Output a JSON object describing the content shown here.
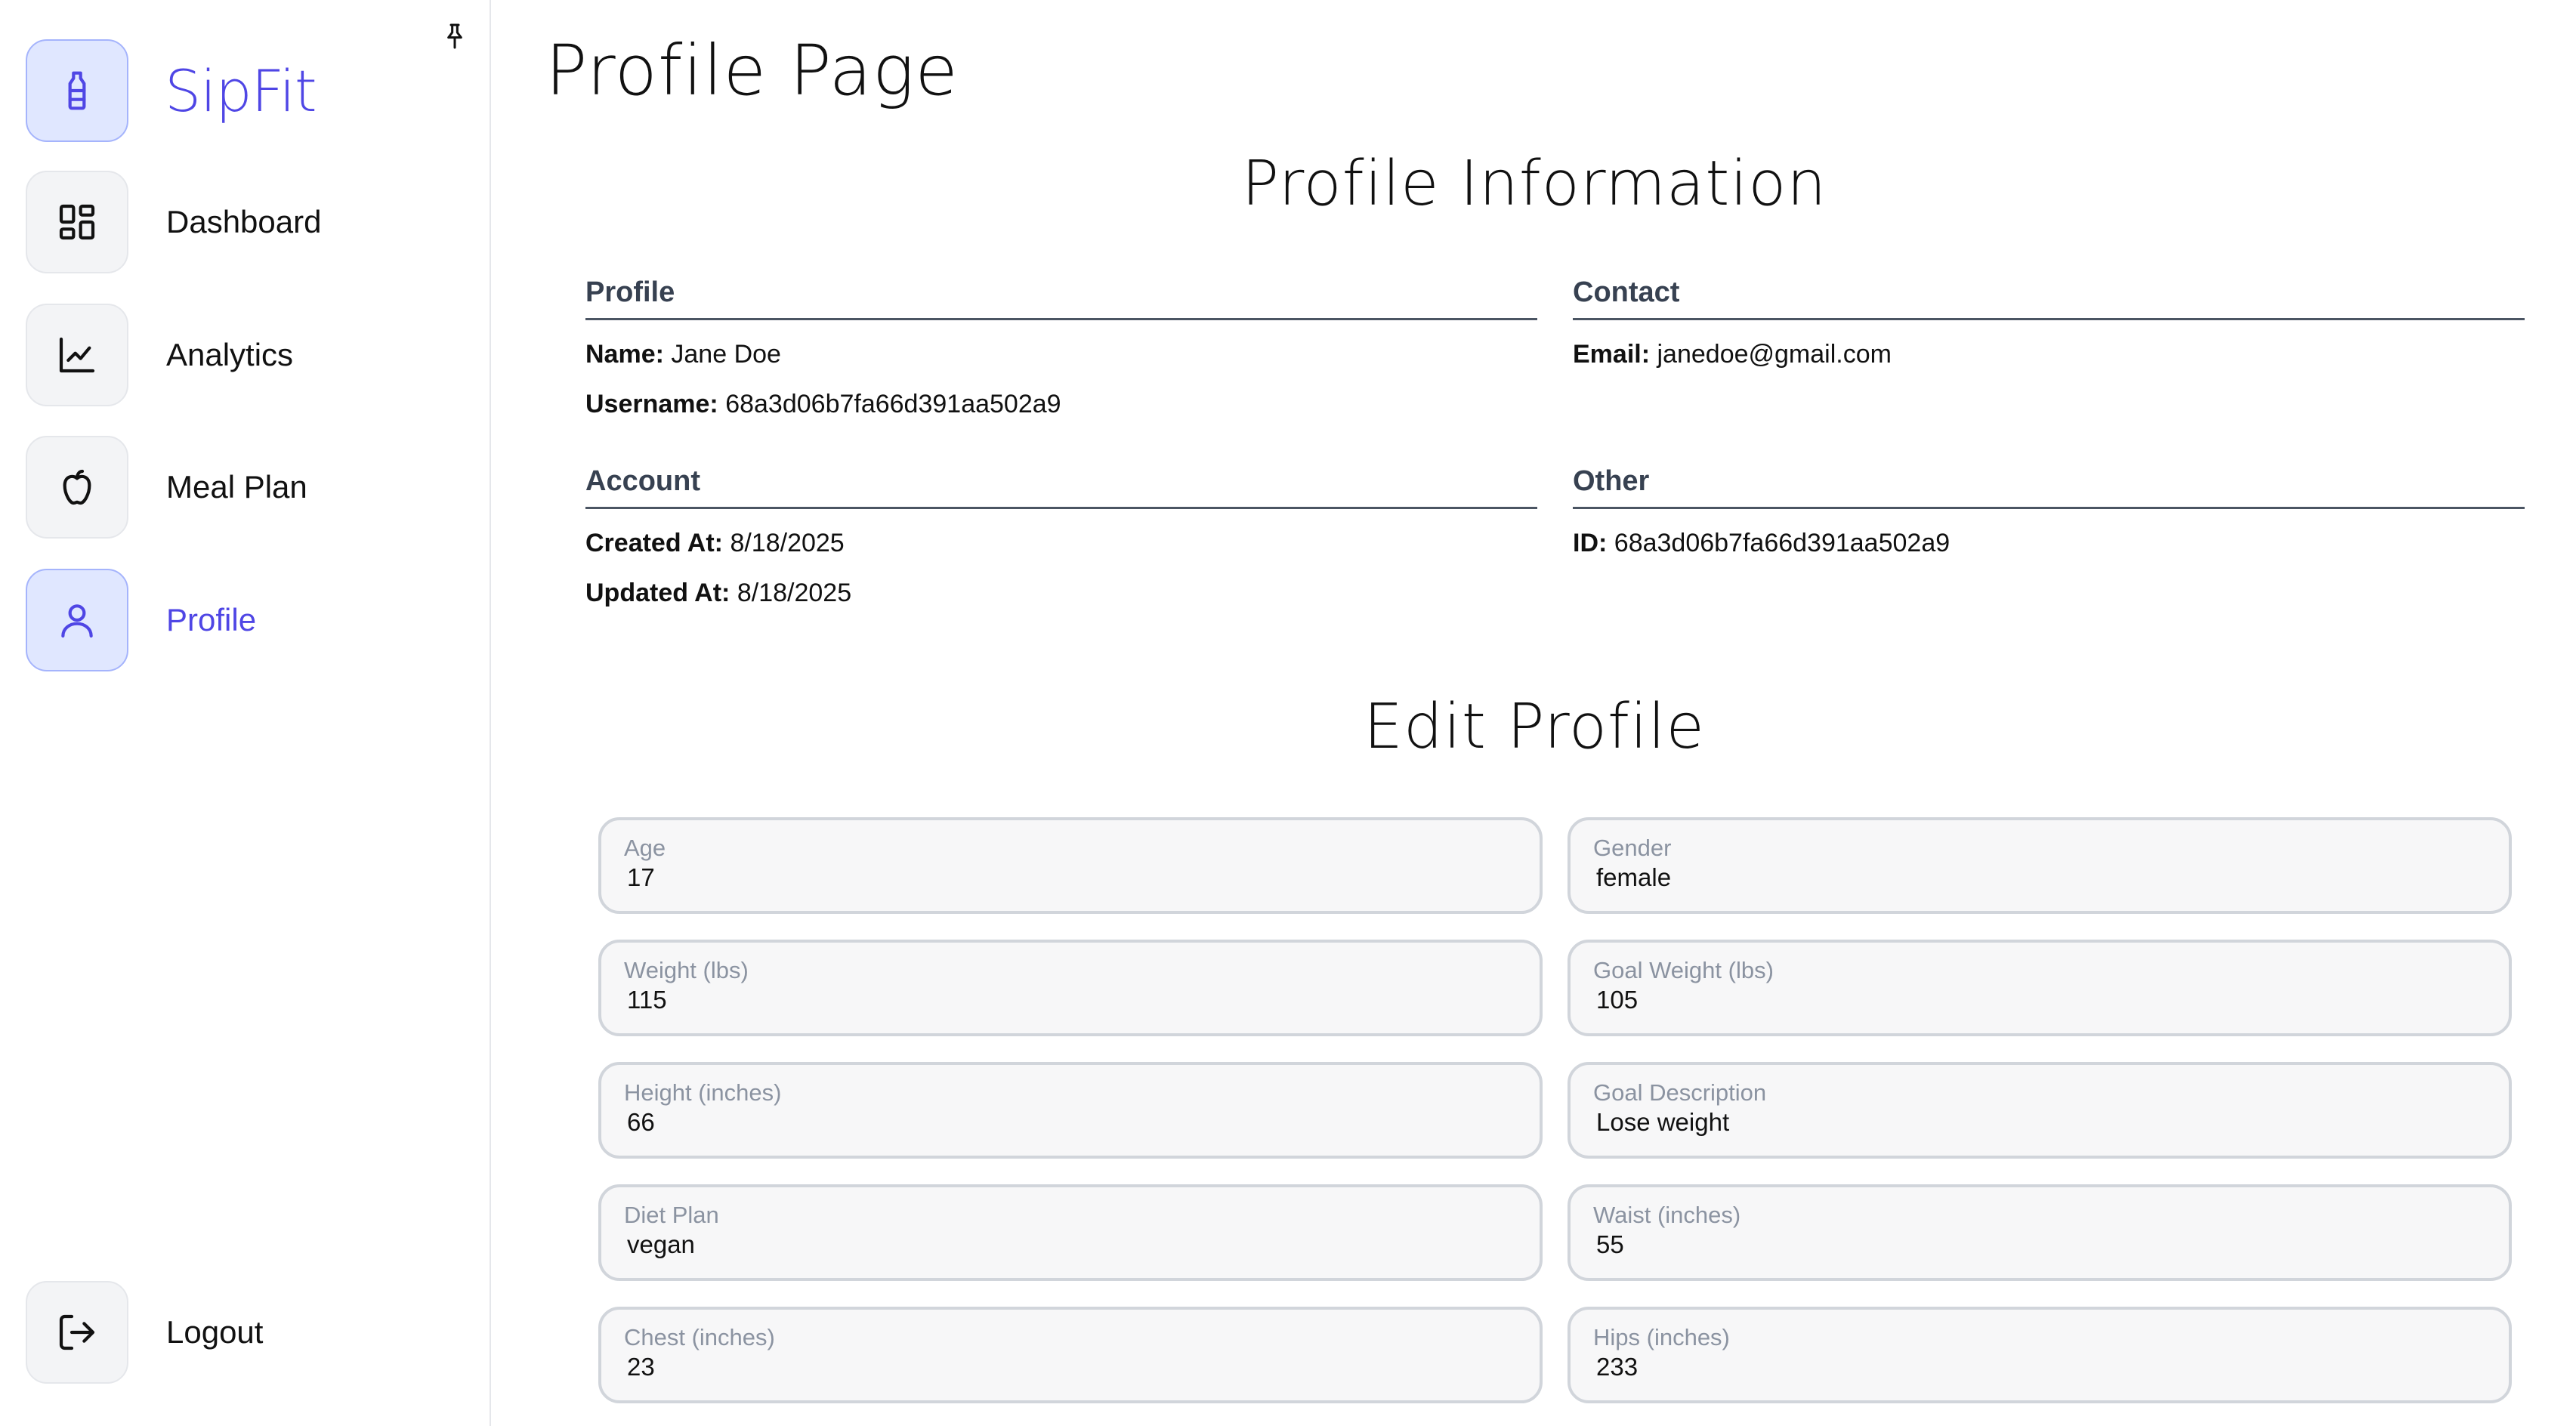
{
  "sidebar": {
    "brand": "SipFit",
    "items": [
      {
        "label": "Dashboard",
        "icon": "grid-icon"
      },
      {
        "label": "Analytics",
        "icon": "chart-line-icon"
      },
      {
        "label": "Meal Plan",
        "icon": "apple-icon"
      },
      {
        "label": "Profile",
        "icon": "user-icon"
      }
    ],
    "logout": "Logout"
  },
  "page": {
    "title": "Profile Page",
    "info_title": "Profile Information",
    "edit_title": "Edit Profile"
  },
  "info": {
    "profile": {
      "heading": "Profile",
      "name_label": "Name:",
      "name": "Jane Doe",
      "username_label": "Username:",
      "username": "68a3d06b7fa66d391aa502a9"
    },
    "contact": {
      "heading": "Contact",
      "email_label": "Email:",
      "email": "janedoe@gmail.com"
    },
    "account": {
      "heading": "Account",
      "created_label": "Created At:",
      "created": "8/18/2025",
      "updated_label": "Updated At:",
      "updated": "8/18/2025"
    },
    "other": {
      "heading": "Other",
      "id_label": "ID:",
      "id": "68a3d06b7fa66d391aa502a9"
    }
  },
  "form": {
    "age": {
      "label": "Age",
      "value": "17"
    },
    "gender": {
      "label": "Gender",
      "value": "female"
    },
    "weight": {
      "label": "Weight (lbs)",
      "value": "115"
    },
    "goal_weight": {
      "label": "Goal Weight (lbs)",
      "value": "105"
    },
    "height": {
      "label": "Height (inches)",
      "value": "66"
    },
    "goal_description": {
      "label": "Goal Description",
      "value": "Lose weight"
    },
    "diet_plan": {
      "label": "Diet Plan",
      "value": "vegan"
    },
    "waist": {
      "label": "Waist (inches)",
      "value": "55"
    },
    "chest": {
      "label": "Chest (inches)",
      "value": "23"
    },
    "hips": {
      "label": "Hips (inches)",
      "value": "233"
    }
  },
  "colors": {
    "accent": "#4f46e5",
    "accent_bg": "#e0e7ff",
    "tile_bg": "#f3f4f6",
    "field_border": "#d1d5db"
  }
}
